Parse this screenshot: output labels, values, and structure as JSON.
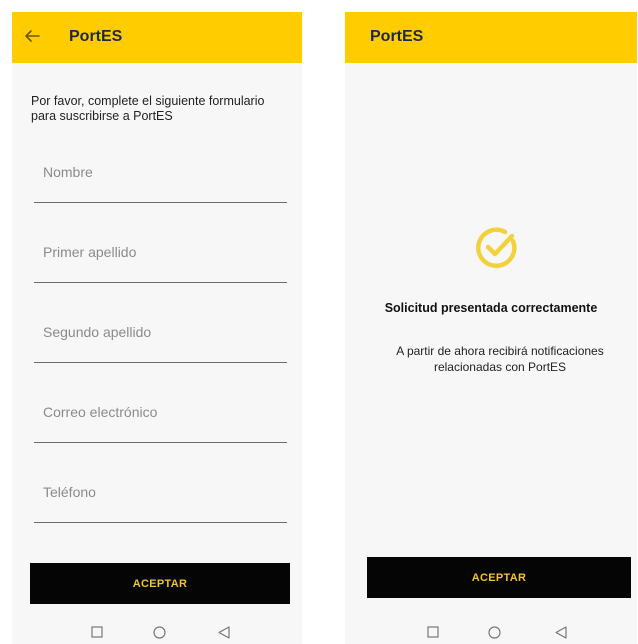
{
  "form_screen": {
    "header": {
      "title": "PortES",
      "back_icon": "arrow-left-icon"
    },
    "intro_text": "Por favor, complete el siguiente formulario para suscribirse a PortES",
    "fields": [
      {
        "placeholder": "Nombre",
        "value": ""
      },
      {
        "placeholder": "Primer apellido",
        "value": ""
      },
      {
        "placeholder": "Segundo apellido",
        "value": ""
      },
      {
        "placeholder": "Correo electrónico",
        "value": ""
      },
      {
        "placeholder": "Teléfono",
        "value": ""
      }
    ],
    "submit_label": "ACEPTAR"
  },
  "success_screen": {
    "header": {
      "title": "PortES"
    },
    "icon": "check-circle-icon",
    "title": "Solicitud presentada correctamente",
    "message": "A partir de ahora recibirá notificaciones relacionadas con PortES",
    "accept_label": "ACEPTAR"
  },
  "nav_bar": {
    "icons": [
      "square-recents-icon",
      "circle-home-icon",
      "triangle-back-icon"
    ]
  },
  "colors": {
    "accent": "#ffcc00",
    "button_bg": "#050505",
    "button_text": "#f1c232",
    "check_icon": "#f2d23c"
  }
}
